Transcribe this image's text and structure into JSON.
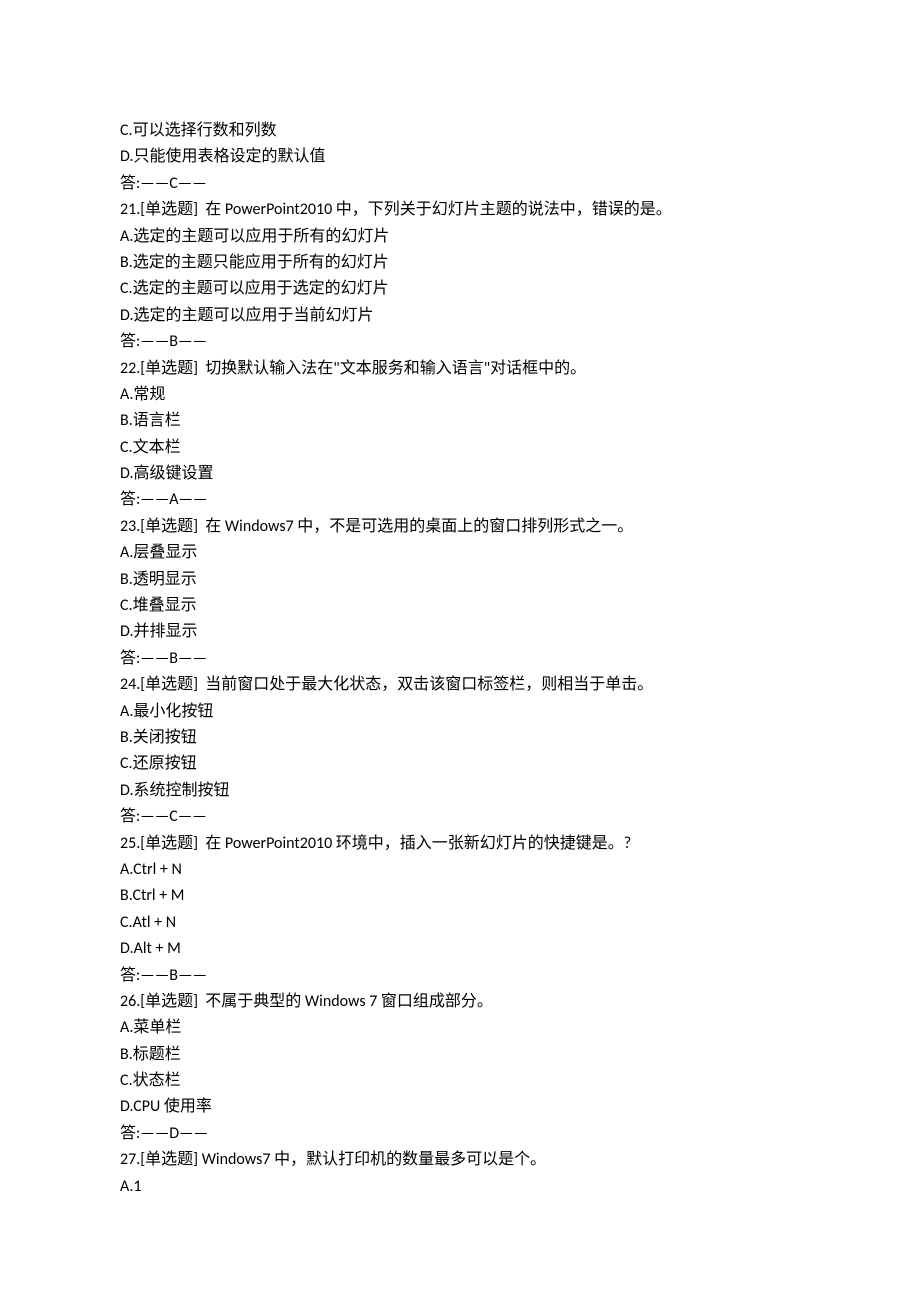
{
  "lines": [
    "C.可以选择行数和列数",
    "D.只能使用表格设定的默认值",
    "答:——C——",
    "21.[单选题]  在 PowerPoint2010 中，下列关于幻灯片主题的说法中，错误的是。",
    "A.选定的主题可以应用于所有的幻灯片",
    "B.选定的主题只能应用于所有的幻灯片",
    "C.选定的主题可以应用于选定的幻灯片",
    "D.选定的主题可以应用于当前幻灯片",
    "答:——B——",
    "22.[单选题]  切换默认输入法在\"文本服务和输入语言\"对话框中的。",
    "A.常规",
    "B.语言栏",
    "C.文本栏",
    "D.高级键设置",
    "答:——A——",
    "23.[单选题]  在 Windows7 中，不是可选用的桌面上的窗口排列形式之一。",
    "A.层叠显示",
    "B.透明显示",
    "C.堆叠显示",
    "D.并排显示",
    "答:——B——",
    "24.[单选题]  当前窗口处于最大化状态，双击该窗口标签栏，则相当于单击。",
    "A.最小化按钮",
    "B.关闭按钮",
    "C.还原按钮",
    "D.系统控制按钮",
    "答:——C——",
    "25.[单选题]  在 PowerPoint2010 环境中，插入一张新幻灯片的快捷键是。?",
    "A.Ctrl + N",
    "B.Ctrl + M",
    "C.Atl + N",
    "D.Alt + M",
    "答:——B——",
    "26.[单选题]  不属于典型的 Windows 7 窗口组成部分。",
    "A.菜单栏",
    "B.标题栏",
    "C.状态栏",
    "D.CPU 使用率",
    "答:——D——",
    "27.[单选题] Windows7 中，默认打印机的数量最多可以是个。",
    "A.1"
  ]
}
